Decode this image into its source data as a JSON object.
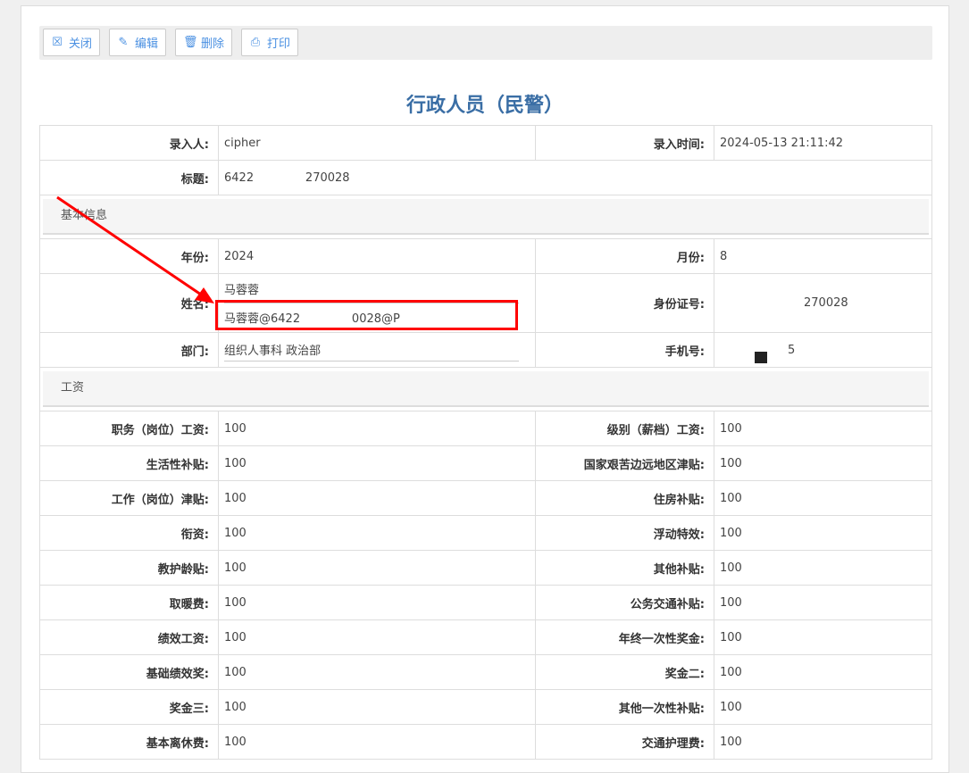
{
  "toolbar": {
    "close": "关闭",
    "edit": "编辑",
    "delete": "删除",
    "print": "打印"
  },
  "title": "行政人员（民警）",
  "meta": {
    "entered_by_label": "录入人:",
    "entered_by": "cipher",
    "entered_time_label": "录入时间:",
    "entered_time": "2024-05-13 21:11:42",
    "subject_label": "标题:",
    "subject": "6422              270028"
  },
  "basic": {
    "section": "基本信息",
    "year_label": "年份:",
    "year": "2024",
    "month_label": "月份:",
    "month": "8",
    "name_label": "姓名:",
    "name": "马蓉蓉",
    "name_full": "马蓉蓉@6422              0028@P",
    "id_label": "身份证号:",
    "id": "270028",
    "dept_label": "部门:",
    "dept": "组织人事科 政治部",
    "phone_label": "手机号:",
    "phone": "5"
  },
  "salary": {
    "section": "工资",
    "rows": [
      [
        "职务（岗位）工资:",
        "100",
        "级别（薪档）工资:",
        "100"
      ],
      [
        "生活性补贴:",
        "100",
        "国家艰苦边远地区津贴:",
        "100"
      ],
      [
        "工作（岗位）津贴:",
        "100",
        "住房补贴:",
        "100"
      ],
      [
        "衔资:",
        "100",
        "浮动特效:",
        "100"
      ],
      [
        "教护龄贴:",
        "100",
        "其他补贴:",
        "100"
      ],
      [
        "取暖费:",
        "100",
        "公务交通补贴:",
        "100"
      ],
      [
        "绩效工资:",
        "100",
        "年终一次性奖金:",
        "100"
      ],
      [
        "基础绩效奖:",
        "100",
        "奖金二:",
        "100"
      ],
      [
        "奖金三:",
        "100",
        "其他一次性补贴:",
        "100"
      ],
      [
        "基本离休费:",
        "100",
        "交通护理费:",
        "100"
      ]
    ]
  }
}
